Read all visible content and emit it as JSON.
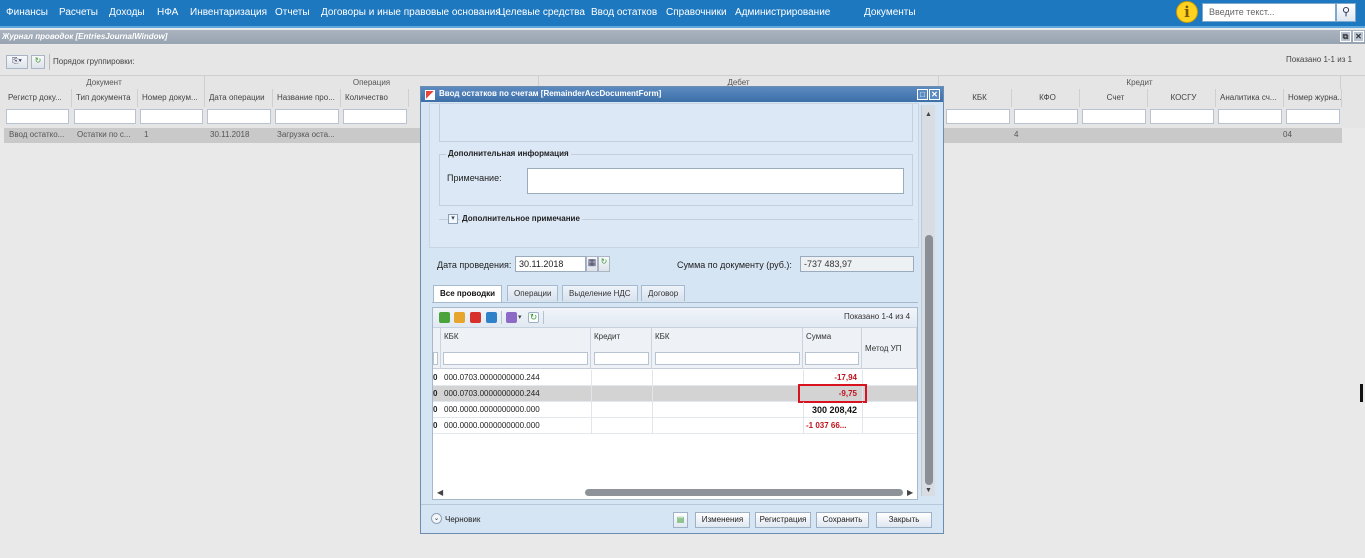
{
  "top_menu": {
    "items": [
      "Финансы",
      "Расчеты",
      "Доходы",
      "НФА",
      "Инвентаризация",
      "Отчеты",
      "Договоры и иные правовые основания",
      "Целевые средства",
      "Ввод остатков",
      "Справочники",
      "Администрирование",
      "Документы"
    ],
    "search_placeholder": "Введите текст..."
  },
  "journal": {
    "title": "Журнал проводок [EntriesJournalWindow]",
    "grouping_label": "Порядок группировки:",
    "shown": "Показано 1-1 из 1",
    "groups": [
      "Документ",
      "Операция",
      "Дебет",
      "Кредит"
    ],
    "columns": [
      "Регистр доку...",
      "Тип документа",
      "Номер докум...",
      "Дата операции",
      "Название про...",
      "Количество",
      "КБК",
      "КФО",
      "Счет",
      "КОСГУ",
      "Аналитика сч...",
      "Номер журна..."
    ],
    "row": {
      "registry": "Ввод остатко...",
      "doc_type": "Остатки по с...",
      "doc_number": "1",
      "op_date": "30.11.2018",
      "op_name": "Загрузка оста...",
      "kfo": "4",
      "journal_no": "04"
    }
  },
  "dialog": {
    "title": "Ввод остатков по счетам [RemainderAccDocumentForm]",
    "additional_info_legend": "Дополнительная информация",
    "note_label": "Примечание:",
    "note_value": "",
    "extra_note_legend": "Дополнительное примечание",
    "posting_date_label": "Дата проведения:",
    "posting_date_value": "30.11.2018",
    "doc_sum_label": "Сумма по документу (руб.):",
    "doc_sum_value": "-737 483,97",
    "tabs": [
      "Все проводки",
      "Операции",
      "Выделение НДС",
      "Договор"
    ],
    "grid": {
      "shown": "Показано 1-4 из 4",
      "columns": [
        "КБК",
        "Кредит",
        "КБК",
        "Сумма",
        "Метод УП"
      ],
      "rows": [
        {
          "prefix": "0",
          "kbk": "000.0703.0000000000.244",
          "sum": "-17,94",
          "selected": false
        },
        {
          "prefix": "0",
          "kbk": "000.0703.0000000000.244",
          "sum": "-9,75",
          "selected": true
        },
        {
          "prefix": "0",
          "kbk": "000.0000.0000000000.000",
          "sum": "300 208,42",
          "selected": false
        },
        {
          "prefix": "0",
          "kbk": "000.0000.0000000000.000",
          "sum": "-1 037 66...",
          "selected": false
        }
      ]
    },
    "status": "Черновик",
    "buttons": [
      "Изменения",
      "Регистрация",
      "Сохранить",
      "Закрыть"
    ]
  },
  "colors": {
    "menu_bg": "#1d78c0",
    "negative": "#c0141c",
    "highlight_box": "#d8121e",
    "dialog_bg": "#d6e5f4"
  }
}
